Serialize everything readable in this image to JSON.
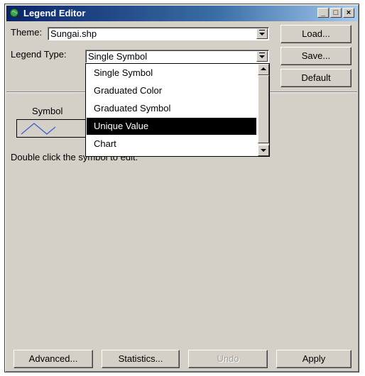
{
  "window": {
    "title": "Legend Editor",
    "minimize_glyph": "_",
    "maximize_glyph": "□",
    "close_glyph": "×"
  },
  "theme": {
    "label": "Theme:",
    "value": "Sungai.shp"
  },
  "legend_type": {
    "label": "Legend Type:",
    "value": "Single Symbol",
    "options": [
      "Single Symbol",
      "Graduated Color",
      "Graduated Symbol",
      "Unique Value",
      "Chart"
    ],
    "highlighted": "Unique Value"
  },
  "side_buttons": {
    "load": "Load...",
    "save": "Save...",
    "default": "Default"
  },
  "symbol_section": {
    "header": "Symbol",
    "hint": "Double click the symbol to edit."
  },
  "bottom_buttons": {
    "advanced": "Advanced...",
    "statistics": "Statistics...",
    "undo": "Undo",
    "apply": "Apply"
  },
  "colors": {
    "title_bar": "#0a246a",
    "face": "#d4d0c8",
    "symbol_line": "#4060d0",
    "selection": "#000000"
  },
  "icons": {
    "app": "globe-magnifier-icon",
    "symbol": "zigzag-line-symbol"
  }
}
